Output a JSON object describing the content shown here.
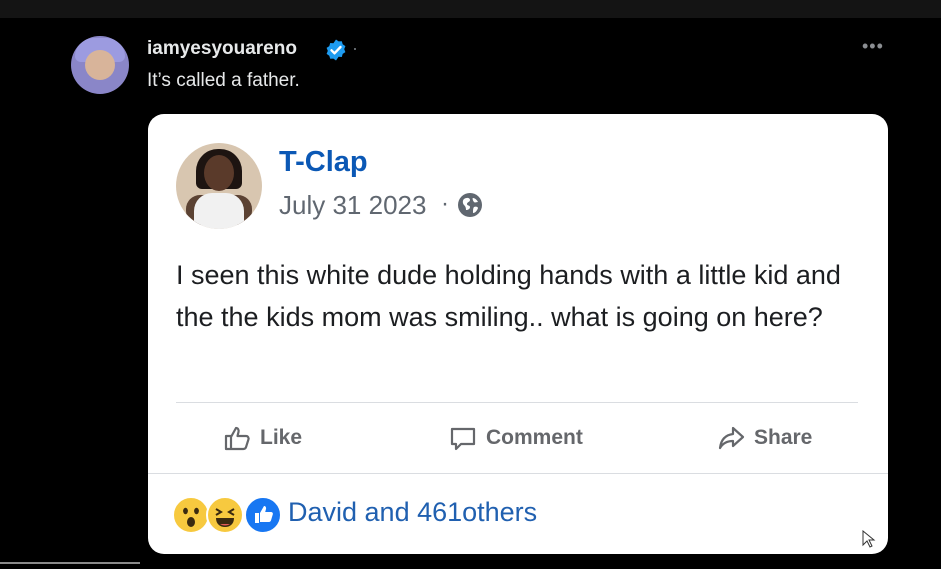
{
  "tweet": {
    "username": "iamyesyouareno",
    "caption": "It’s called a father.",
    "more_label": "•••",
    "separator": "·"
  },
  "fb_post": {
    "author": "T-Clap",
    "date": "July 31 2023",
    "date_separator": "·",
    "text": "I seen this white dude holding hands with a little kid and the the kids mom was smiling.. what is going on here?",
    "actions": {
      "like": "Like",
      "comment": "Comment",
      "share": "Share"
    },
    "reactions_summary": "David and 461others"
  },
  "colors": {
    "background": "#000000",
    "card": "#ffffff",
    "fb_blue": "#0b58b5",
    "x_verified": "#1d9bf0",
    "muted": "#65676b"
  },
  "icons": [
    "verified-badge-icon",
    "more-icon",
    "globe-icon",
    "like-thumb-icon",
    "comment-bubble-icon",
    "share-arrow-icon",
    "wow-reaction-icon",
    "haha-reaction-icon",
    "like-reaction-icon",
    "mouse-cursor-icon"
  ]
}
